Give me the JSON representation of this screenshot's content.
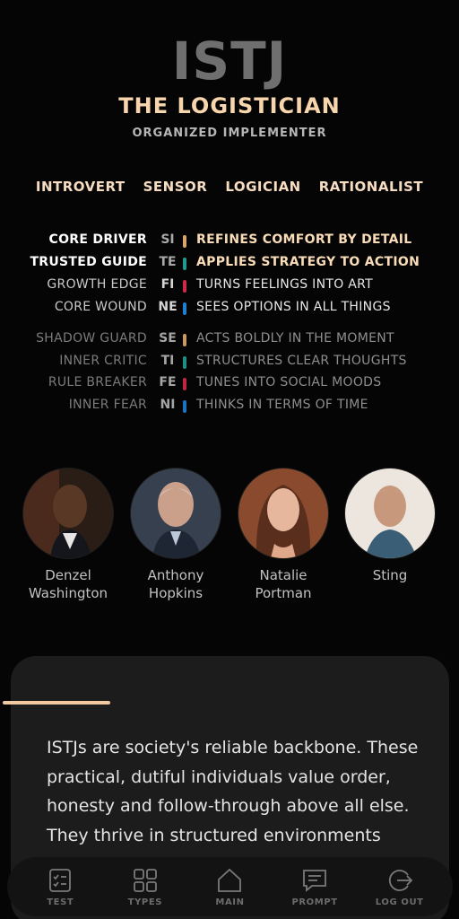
{
  "header": {
    "code": "ISTJ",
    "name": "THE LOGISTICIAN",
    "subtitle": "ORGANIZED IMPLEMENTER"
  },
  "traits": [
    "INTROVERT",
    "SENSOR",
    "LOGICIAN",
    "RATIONALIST"
  ],
  "functions": [
    {
      "label": "CORE DRIVER",
      "code": "SI",
      "desc": "REFINES COMFORT BY DETAIL",
      "color": "#d9a56a",
      "tier": "strong"
    },
    {
      "label": "TRUSTED GUIDE",
      "code": "TE",
      "desc": "APPLIES STRATEGY TO ACTION",
      "color": "#1f9a8f",
      "tier": "strong"
    },
    {
      "label": "GROWTH EDGE",
      "code": "FI",
      "desc": "TURNS FEELINGS INTO ART",
      "color": "#d2294a",
      "tier": "mid"
    },
    {
      "label": "CORE WOUND",
      "code": "NE",
      "desc": "SEES OPTIONS IN ALL THINGS",
      "color": "#1f7fd1",
      "tier": "mid"
    },
    {
      "label": "SHADOW GUARD",
      "code": "SE",
      "desc": "ACTS BOLDLY IN THE MOMENT",
      "color": "#c79a63",
      "tier": "dim"
    },
    {
      "label": "INNER CRITIC",
      "code": "TI",
      "desc": "STRUCTURES CLEAR THOUGHTS",
      "color": "#1f8f85",
      "tier": "dim"
    },
    {
      "label": "RULE BREAKER",
      "code": "FE",
      "desc": "TUNES INTO SOCIAL MOODS",
      "color": "#c22444",
      "tier": "dim"
    },
    {
      "label": "INNER FEAR",
      "code": "NI",
      "desc": "THINKS IN TERMS OF TIME",
      "color": "#1b74c2",
      "tier": "dim"
    }
  ],
  "people": [
    {
      "name": "Denzel\nWashington"
    },
    {
      "name": "Anthony\nHopkins"
    },
    {
      "name": "Natalie\nPortman"
    },
    {
      "name": "Sting"
    }
  ],
  "description": "ISTJs are society's reliable backbone. These practical, dutiful individuals value order, honesty and follow-through above all else. They thrive in structured environments",
  "nav": [
    {
      "label": "TEST",
      "icon": "checklist-icon"
    },
    {
      "label": "TYPES",
      "icon": "grid-icon"
    },
    {
      "label": "MAIN",
      "icon": "home-icon"
    },
    {
      "label": "PROMPT",
      "icon": "chat-icon"
    },
    {
      "label": "LOG OUT",
      "icon": "logout-icon"
    }
  ]
}
